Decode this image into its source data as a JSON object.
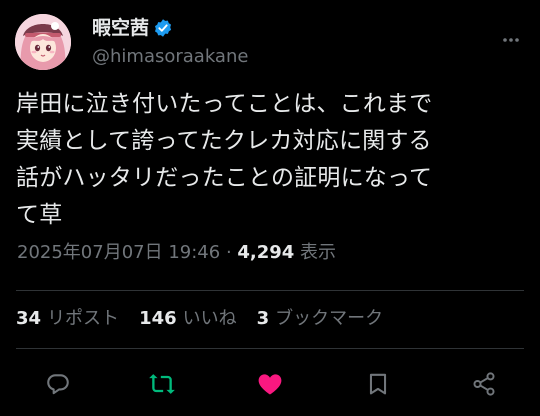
{
  "user": {
    "display_name": "暇空茜",
    "handle": "@himasoraakane",
    "verified": true
  },
  "tweet": {
    "lines": [
      "岸田に泣き付いたってことは、これまで",
      "実績として誇ってたクレカ対応に関する",
      "話がハッタリだったことの証明になって",
      "て草"
    ]
  },
  "meta": {
    "timestamp": "2025年07月07日 19:46",
    "separator": " · ",
    "views_count": "4,294",
    "views_label": " 表示"
  },
  "stats": {
    "reposts_count": "34",
    "reposts_label": "リポスト",
    "likes_count": "146",
    "likes_label": "いいね",
    "bookmarks_count": "3",
    "bookmarks_label": "ブックマーク"
  },
  "colors": {
    "background": "#000000",
    "text": "#e7e9ea",
    "muted": "#71767b",
    "verified": "#1d9bf0",
    "repost_active": "#00ba7c",
    "like_active": "#f91880"
  },
  "icons": {
    "verified": "verified-badge-icon",
    "more": "more-icon",
    "reply": "reply-icon",
    "repost": "repost-icon",
    "like": "heart-icon",
    "bookmark": "bookmark-icon",
    "share": "share-icon"
  }
}
